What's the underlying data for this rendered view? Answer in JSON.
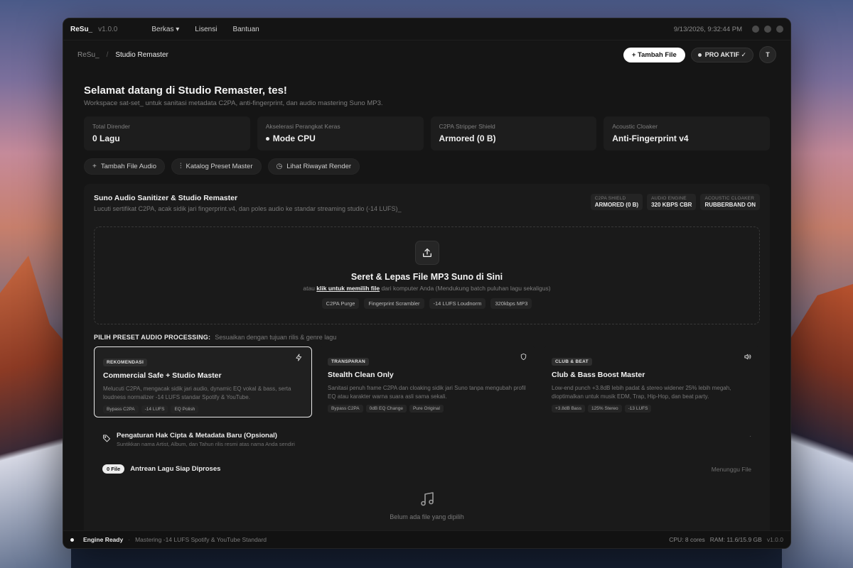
{
  "app": {
    "brand": "ReSu_",
    "version": "v1.0.0",
    "menu": [
      "Berkas ▾",
      "Lisensi",
      "Bantuan"
    ],
    "clock": "9/13/2026, 9:32:44 PM"
  },
  "nav": {
    "breadcrumb_root": "ReSu_",
    "breadcrumb_separator": "/",
    "breadcrumb_current": "Studio Remaster",
    "add_file_label": "+ Tambah File",
    "pro_label": "PRO AKTIF ✓",
    "avatar_initial": "T"
  },
  "welcome": {
    "title": "Selamat datang di Studio Remaster, tes!",
    "subtitle": "Workspace sat-set_ untuk sanitasi metadata C2PA, anti-fingerprint, dan audio mastering Suno MP3."
  },
  "stats": [
    {
      "label": "Total Dirender",
      "value": "0 Lagu",
      "dot": false
    },
    {
      "label": "Akselerasi Perangkat Keras",
      "value": "Mode CPU",
      "dot": true
    },
    {
      "label": "C2PA Stripper Shield",
      "value": "Armored (0 B)",
      "dot": false
    },
    {
      "label": "Acoustic Cloaker",
      "value": "Anti-Fingerprint v4",
      "dot": false
    }
  ],
  "actions": [
    {
      "icon": "plus-icon",
      "glyph": "+",
      "label": "Tambah File Audio"
    },
    {
      "icon": "sliders-icon",
      "glyph": "⫶",
      "label": "Katalog Preset Master"
    },
    {
      "icon": "history-icon",
      "glyph": "◷",
      "label": "Lihat Riwayat Render"
    }
  ],
  "panel": {
    "title": "Suno Audio Sanitizer & Studio Remaster",
    "subtitle": "Lucuti sertifikat C2PA, acak sidik jari fingerprint.v4, dan poles audio ke standar streaming studio (-14 LUFS)_",
    "chips": [
      {
        "key": "C2PA SHIELD",
        "value": "ARMORED (0 B)"
      },
      {
        "key": "AUDIO ENGINE",
        "value": "320 KBPS CBR"
      },
      {
        "key": "ACOUSTIC CLOAKER",
        "value": "RUBBERBAND ON"
      }
    ]
  },
  "dropzone": {
    "title": "Seret & Lepas File MP3 Suno di Sini",
    "sub_prefix": "atau",
    "sub_link": "klik untuk memilih file",
    "sub_suffix": "dari komputer Anda (Mendukung batch puluhan lagu sekaligus)",
    "tags": [
      "C2PA Purge",
      "Fingerprint Scrambler",
      "-14 LUFS Loudnorm",
      "320kbps MP3"
    ]
  },
  "presets_section": {
    "heading": "PILIH PRESET AUDIO PROCESSING:",
    "hint": "Sesuaikan dengan tujuan rilis & genre lagu"
  },
  "presets": [
    {
      "badge": "REKOMENDASI",
      "icon": "bolt-icon",
      "title": "Commercial Safe + Studio Master",
      "desc": "Melucuti C2PA, mengacak sidik jari audio, dynamic EQ vokal & bass, serta loudness normalizer -14 LUFS standar Spotify & YouTube.",
      "tags": [
        "Bypass C2PA",
        "-14 LUFS",
        "EQ Polish"
      ],
      "active": true
    },
    {
      "badge": "TRANSPARAN",
      "icon": "shield-icon",
      "title": "Stealth Clean Only",
      "desc": "Sanitasi penuh frame C2PA dan cloaking sidik jari Suno tanpa mengubah profil EQ atau karakter warna suara asli sama sekali.",
      "tags": [
        "Bypass C2PA",
        "0dB EQ Change",
        "Pure Original"
      ],
      "active": false
    },
    {
      "badge": "CLUB & BEAT",
      "icon": "speaker-icon",
      "title": "Club & Bass Boost Master",
      "desc": "Low-end punch +3.8dB lebih padat & stereo widener 25% lebih megah, dioptimalkan untuk musik EDM, Trap, Hip-Hop, dan beat party.",
      "tags": [
        "+3.8dB Bass",
        "125% Stereo",
        "-13 LUFS"
      ],
      "active": false
    }
  ],
  "metadata": {
    "title": "Pengaturan Hak Cipta & Metadata Baru (Opsional)",
    "subtitle": "Suntikkan nama Artist, Album, dan Tahun rilis resmi atas nama Anda sendiri",
    "caret": "·"
  },
  "queue": {
    "count": "0 File",
    "title": "Antrean Lagu Siap Diproses",
    "status": "Menunggu File",
    "empty_text": "Belum ada file yang dipilih"
  },
  "statusbar": {
    "ready": "Engine Ready",
    "separator": "·",
    "mode": "Mastering -14 LUFS Spotify & YouTube Standard",
    "cpu": "CPU: 8 cores",
    "ram": "RAM: 11.6/15.9 GB",
    "version": "v1.0.0"
  }
}
